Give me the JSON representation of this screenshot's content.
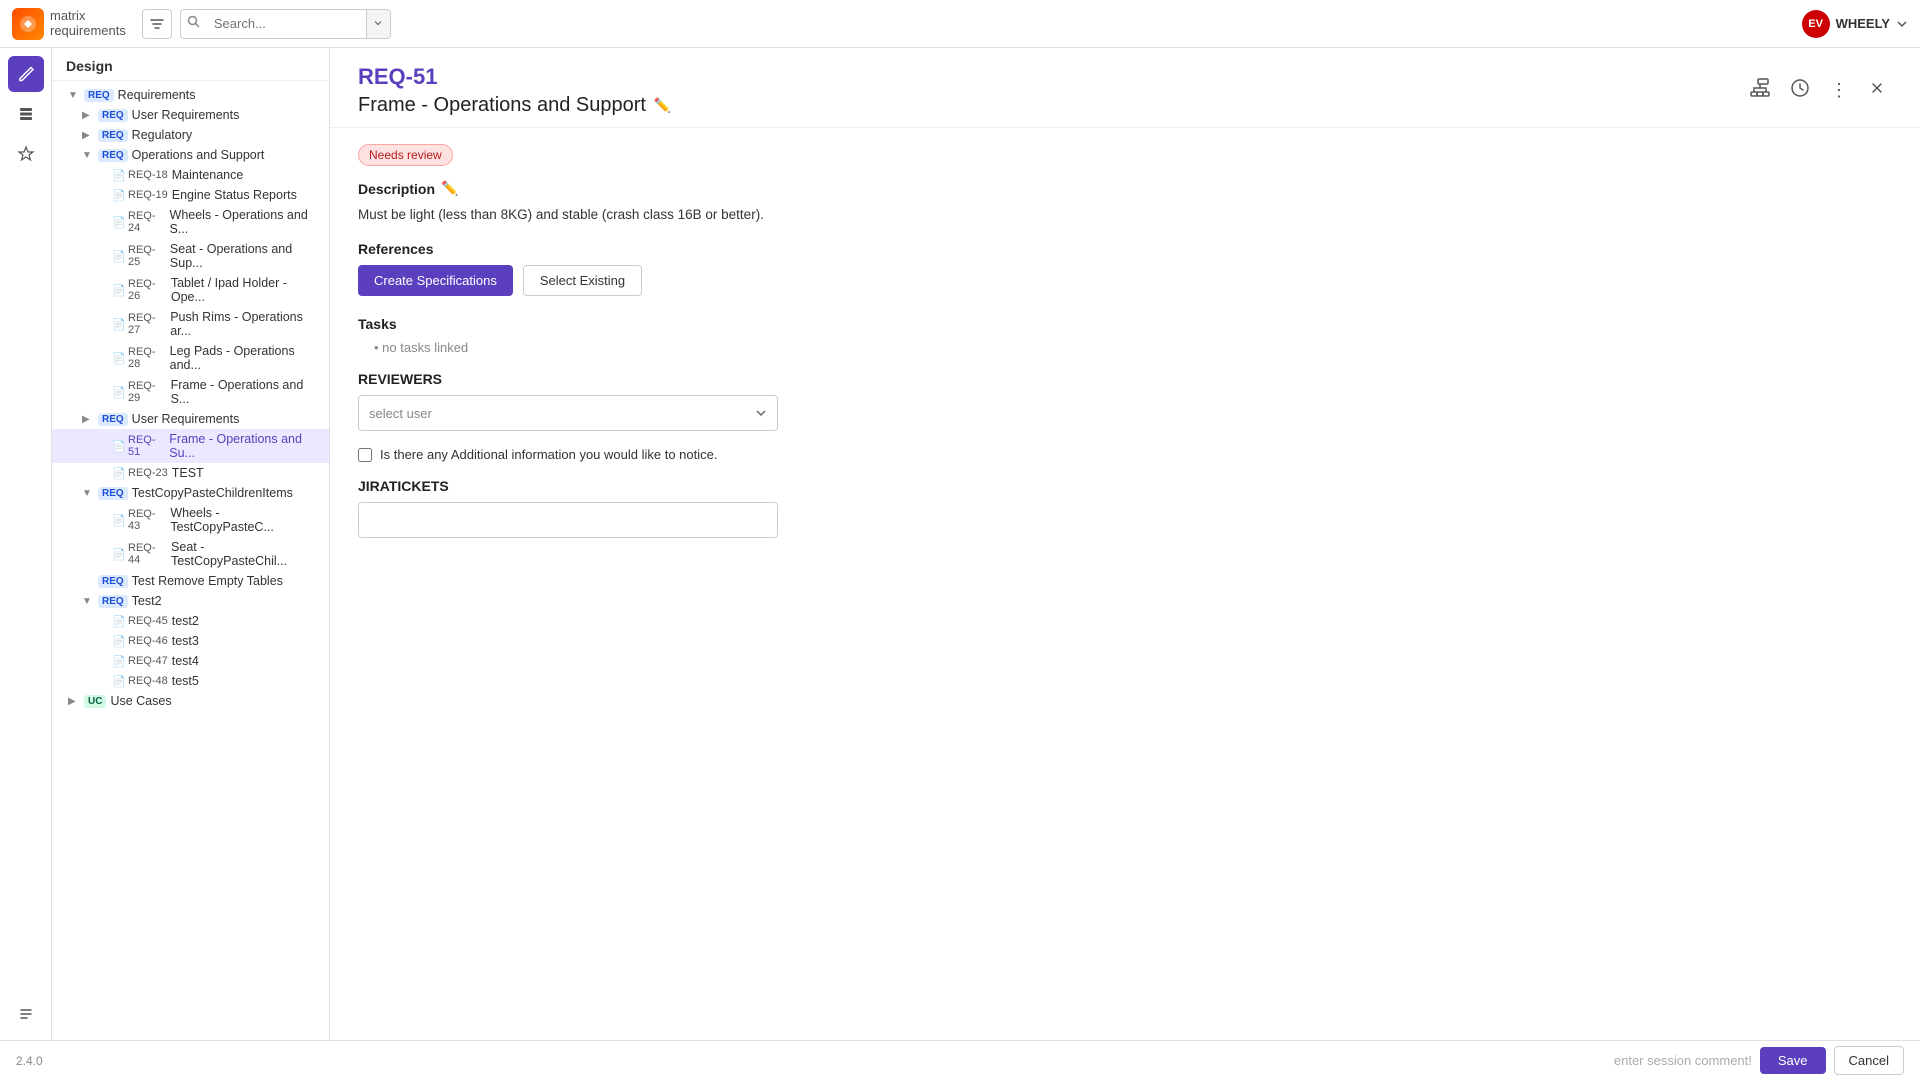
{
  "logo": {
    "line1": "matrix",
    "line2": "requirements"
  },
  "topbar": {
    "search_placeholder": "Search...",
    "user_initials": "EV",
    "user_name": "WHEELY"
  },
  "sidebar": {
    "section_title": "Design"
  },
  "tree": {
    "items": [
      {
        "id": 1,
        "level": 0,
        "chevron": "▼",
        "badge": "REQ",
        "badge_type": "req",
        "label": "Requirements",
        "icon": ""
      },
      {
        "id": 2,
        "level": 1,
        "chevron": "▶",
        "badge": "REQ",
        "badge_type": "req",
        "label": "User Requirements",
        "icon": ""
      },
      {
        "id": 3,
        "level": 1,
        "chevron": "▶",
        "badge": "REQ",
        "badge_type": "req",
        "label": "Regulatory",
        "icon": ""
      },
      {
        "id": 4,
        "level": 1,
        "chevron": "▼",
        "badge": "REQ",
        "badge_type": "req",
        "label": "Operations and Support",
        "icon": ""
      },
      {
        "id": 5,
        "level": 2,
        "chevron": "",
        "badge": "REQ-18",
        "badge_type": "",
        "label": "Maintenance",
        "icon": "📄"
      },
      {
        "id": 6,
        "level": 2,
        "chevron": "",
        "badge": "REQ-19",
        "badge_type": "",
        "label": "Engine Status Reports",
        "icon": "📄"
      },
      {
        "id": 7,
        "level": 2,
        "chevron": "",
        "badge": "REQ-24",
        "badge_type": "",
        "label": "Wheels - Operations and S...",
        "icon": "📄"
      },
      {
        "id": 8,
        "level": 2,
        "chevron": "",
        "badge": "REQ-25",
        "badge_type": "",
        "label": "Seat - Operations and Sup...",
        "icon": "📄"
      },
      {
        "id": 9,
        "level": 2,
        "chevron": "",
        "badge": "REQ-26",
        "badge_type": "",
        "label": "Tablet / Ipad Holder - Ope...",
        "icon": "📄"
      },
      {
        "id": 10,
        "level": 2,
        "chevron": "",
        "badge": "REQ-27",
        "badge_type": "",
        "label": "Push Rims - Operations ar...",
        "icon": "📄"
      },
      {
        "id": 11,
        "level": 2,
        "chevron": "",
        "badge": "REQ-28",
        "badge_type": "",
        "label": "Leg Pads - Operations and...",
        "icon": "📄"
      },
      {
        "id": 12,
        "level": 2,
        "chevron": "",
        "badge": "REQ-29",
        "badge_type": "",
        "label": "Frame - Operations and S...",
        "icon": "📄"
      },
      {
        "id": 13,
        "level": 1,
        "chevron": "▶",
        "badge": "REQ",
        "badge_type": "req",
        "label": "User Requirements",
        "icon": ""
      },
      {
        "id": 14,
        "level": 2,
        "chevron": "",
        "badge": "REQ-51",
        "badge_type": "selected",
        "label": "Frame - Operations and Su...",
        "icon": "📄",
        "selected": true
      },
      {
        "id": 15,
        "level": 2,
        "chevron": "",
        "badge": "REQ-23",
        "badge_type": "",
        "label": "TEST",
        "icon": "📄"
      },
      {
        "id": 16,
        "level": 1,
        "chevron": "▼",
        "badge": "REQ",
        "badge_type": "req",
        "label": "TestCopyPasteChildrenItems",
        "icon": ""
      },
      {
        "id": 17,
        "level": 2,
        "chevron": "",
        "badge": "REQ-43",
        "badge_type": "",
        "label": "Wheels - TestCopyPasteC...",
        "icon": "📄"
      },
      {
        "id": 18,
        "level": 2,
        "chevron": "",
        "badge": "REQ-44",
        "badge_type": "",
        "label": "Seat - TestCopyPasteChil...",
        "icon": "📄"
      },
      {
        "id": 19,
        "level": 1,
        "chevron": "",
        "badge": "REQ",
        "badge_type": "req",
        "label": "Test Remove Empty Tables",
        "icon": ""
      },
      {
        "id": 20,
        "level": 1,
        "chevron": "▼",
        "badge": "REQ",
        "badge_type": "req",
        "label": "Test2",
        "icon": ""
      },
      {
        "id": 21,
        "level": 2,
        "chevron": "",
        "badge": "REQ-45",
        "badge_type": "",
        "label": "test2",
        "icon": "📄"
      },
      {
        "id": 22,
        "level": 2,
        "chevron": "",
        "badge": "REQ-46",
        "badge_type": "",
        "label": "test3",
        "icon": "📄"
      },
      {
        "id": 23,
        "level": 2,
        "chevron": "",
        "badge": "REQ-47",
        "badge_type": "",
        "label": "test4",
        "icon": "📄"
      },
      {
        "id": 24,
        "level": 2,
        "chevron": "",
        "badge": "REQ-48",
        "badge_type": "",
        "label": "test5",
        "icon": "📄"
      },
      {
        "id": 25,
        "level": 0,
        "chevron": "▶",
        "badge": "UC",
        "badge_type": "uc",
        "label": "Use Cases",
        "icon": ""
      }
    ]
  },
  "content": {
    "item_id": "REQ-51",
    "item_title": "Frame - Operations and Support",
    "status_label": "Needs review",
    "description_label": "Description",
    "description_text": "Must be light (less than 8KG) and stable (crash class 16B or better).",
    "references_label": "References",
    "create_specs_btn": "Create Specifications",
    "select_existing_btn": "Select Existing",
    "tasks_label": "Tasks",
    "no_tasks_text": "no tasks linked",
    "reviewers_label": "REVIEWERS",
    "select_user_placeholder": "select user",
    "additional_info_label": "Is there any Additional information you would like to notice.",
    "jira_label": "JIRATICKETS"
  },
  "bottom": {
    "version": "2.4.0",
    "session_comment": "enter session comment!",
    "save_label": "Save",
    "cancel_label": "Cancel"
  }
}
